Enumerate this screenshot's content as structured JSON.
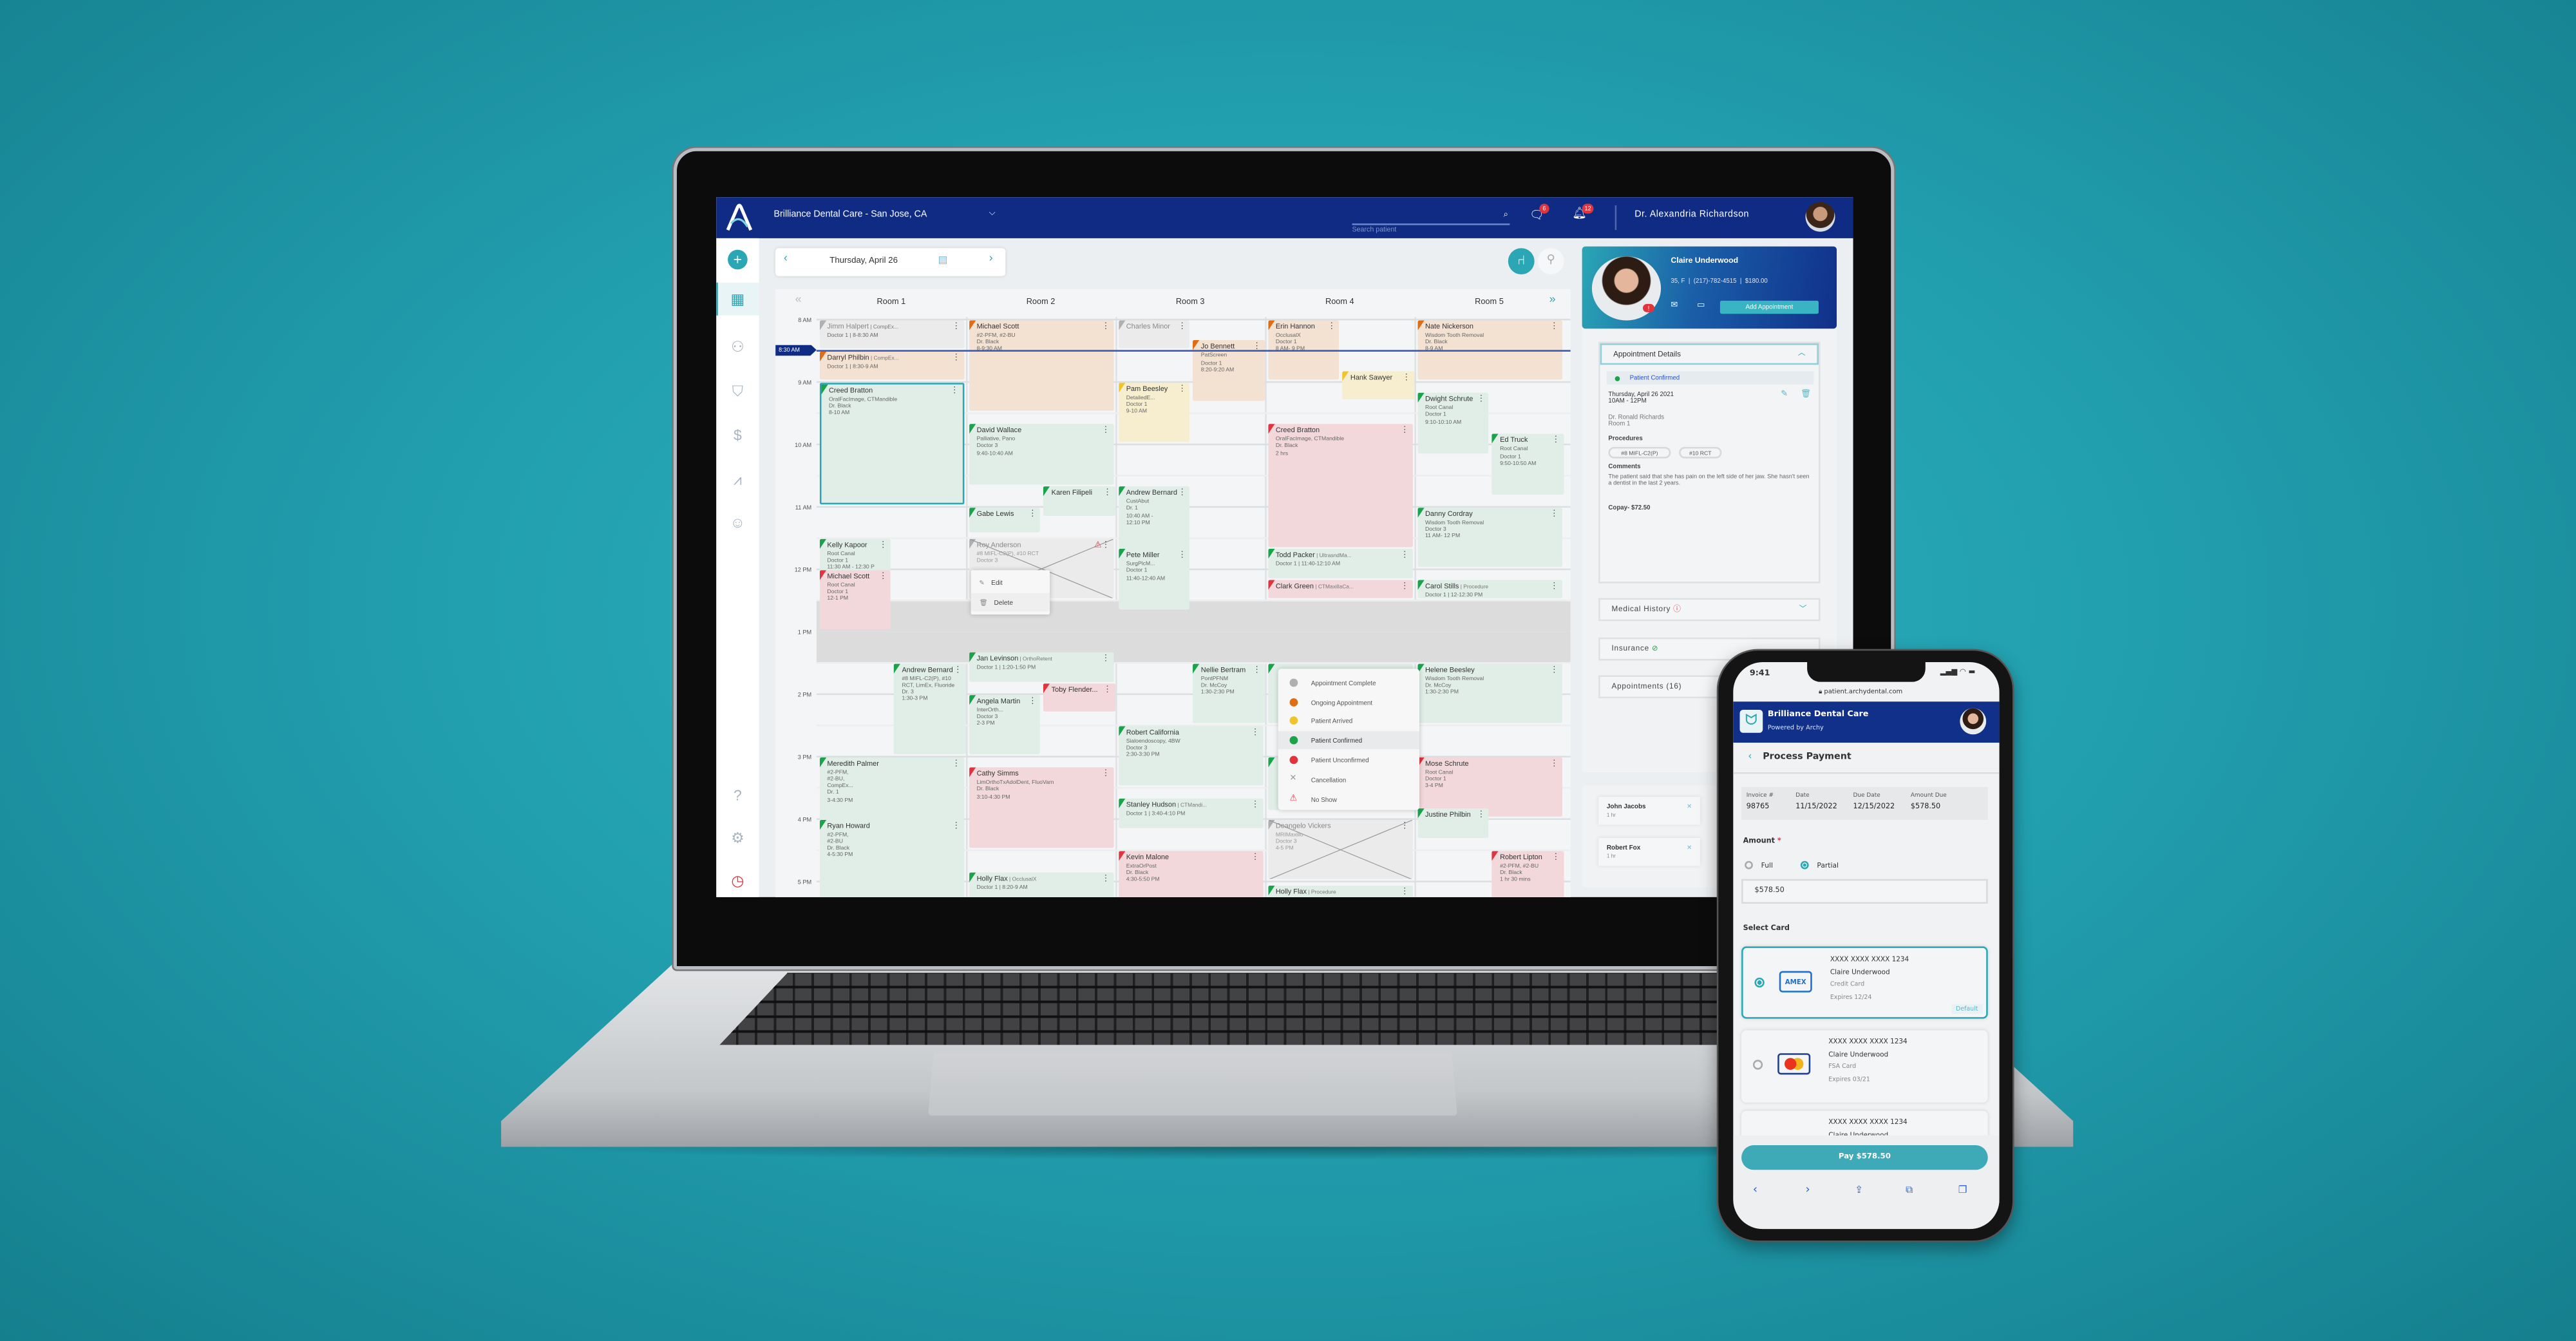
{
  "app": {
    "clinic": "Brilliance Dental Care - San Jose, CA",
    "search_placeholder": "Search patient",
    "messages_badge": "6",
    "notifications_badge": "12",
    "user": "Dr. Alexandria Richardson"
  },
  "schedule": {
    "date": "Thursday, April 26",
    "rooms": [
      "Room 1",
      "Room 2",
      "Room 3",
      "Room 4",
      "Room 5"
    ],
    "hours": [
      "8 AM",
      "9 AM",
      "10 AM",
      "11 AM",
      "12 PM",
      "1 PM",
      "2 PM",
      "3 PM",
      "4 PM",
      "5 PM"
    ],
    "current_time": "8:30 AM",
    "lunch": [
      12.5,
      13.5
    ],
    "appointments": [
      {
        "room": 1,
        "start": 8,
        "end": 8.5,
        "status": "complete",
        "name": "Jimm Halpert",
        "tag": " | CompEx...",
        "lines": [
          "Doctor 1 | 8-8:30 AM"
        ]
      },
      {
        "room": 1,
        "start": 8.5,
        "end": 9,
        "status": "ongoing",
        "name": "Darryl Philbin",
        "tag": " | CompEx...",
        "lines": [
          "Doctor 1 | 8:30-9 AM"
        ]
      },
      {
        "room": 1,
        "start": 9,
        "end": 11,
        "status": "confirmed",
        "selected": true,
        "name": "Creed Bratton",
        "tag": "",
        "lines": [
          "OralFacImage, CTMandible",
          "Dr. Black",
          "8-10 AM"
        ]
      },
      {
        "room": 1,
        "start": 11.5,
        "end": 12.5,
        "status": "confirmed",
        "name": "Kelly Kapoor",
        "tag": "",
        "lines": [
          "Root Canal",
          "Doctor 1",
          "11:30 AM - 12:30 P"
        ]
      },
      {
        "room": 1,
        "start": 12,
        "end": 13,
        "status": "unconfirmed",
        "name": "Michael Scott",
        "tag": "",
        "lines": [
          "Root Canal",
          "Doctor 1",
          "12-1 PM"
        ]
      },
      {
        "room": 1,
        "start": 13.5,
        "end": 15,
        "status": "confirmed",
        "name": "Andrew Bernard",
        "tag": "",
        "lines": [
          "#8 MIFL-C2(P), #10 RCT, LimEx, Fluoride",
          "Dr. 3",
          "1:30-3 PM"
        ]
      },
      {
        "room": 1,
        "start": 15,
        "end": 16.5,
        "status": "confirmed",
        "name": "Meredith Palmer",
        "tag": "",
        "lines": [
          "#2-PFM,",
          "#2-BU,",
          "CompEx...",
          "Dr. 1",
          "3-4:30 PM"
        ]
      },
      {
        "room": 1,
        "start": 16,
        "end": 17.5,
        "status": "confirmed",
        "name": "Ryan Howard",
        "tag": "",
        "lines": [
          "#2-PFM,",
          "#2-BU",
          "Dr. Black",
          "4-5:30 PM"
        ]
      },
      {
        "room": 2,
        "start": 8,
        "end": 9.5,
        "status": "ongoing",
        "name": "Michael Scott",
        "tag": "",
        "lines": [
          "#2-PFM, #2-BU",
          "Dr. Black",
          "8-9:30 AM"
        ]
      },
      {
        "room": 2,
        "start": 9.67,
        "end": 10.67,
        "status": "confirmed",
        "name": "David Wallace",
        "tag": "",
        "lines": [
          "Palliative, Pano",
          "Doctor 3",
          "9:40-10:40 AM"
        ]
      },
      {
        "room": 2,
        "start": 10.67,
        "end": 11.17,
        "status": "confirmed",
        "name": "Karen Filipeli",
        "tag": "",
        "lines": []
      },
      {
        "room": 2,
        "start": 11,
        "end": 11.45,
        "status": "confirmed",
        "name": "Gabe Lewis",
        "tag": "",
        "lines": []
      },
      {
        "room": 2,
        "start": 11.5,
        "end": 12.5,
        "status": "cancellation",
        "noshow": true,
        "name": "Roy Anderson",
        "tag": "",
        "lines": [
          "#8 MIFL-C2(P), #10 RCT",
          "Doctor 3"
        ]
      },
      {
        "room": 2,
        "start": 13.33,
        "end": 13.83,
        "status": "confirmed",
        "name": "Jan Levinson",
        "tag": " | OrthoRetent",
        "lines": [
          "Doctor 1 | 1:20-1:50 PM"
        ]
      },
      {
        "room": 2,
        "start": 14,
        "end": 15,
        "status": "confirmed",
        "name": "Angela Martin",
        "tag": "",
        "lines": [
          "InterOrth...",
          "Doctor 3",
          "2-3 PM"
        ]
      },
      {
        "room": 2,
        "start": 13.83,
        "end": 14.3,
        "status": "unconfirmed",
        "name": "Toby Flender...",
        "tag": "",
        "lines": []
      },
      {
        "room": 2,
        "start": 15.17,
        "end": 16.5,
        "status": "unconfirmed",
        "name": "Cathy Simms",
        "tag": "",
        "lines": [
          "LimOrthoTxAdolDent, FluoVarn",
          "Dr. Black",
          "3:10-4:30 PM"
        ]
      },
      {
        "room": 2,
        "start": 16.85,
        "end": 17.5,
        "status": "confirmed",
        "name": "Holly Flax",
        "tag": " | OcclusalX",
        "lines": [
          "Doctor 1 | 8:20-9 AM"
        ]
      },
      {
        "room": 3,
        "start": 8,
        "end": 8.5,
        "status": "complete",
        "name": "Charles Minor",
        "tag": "",
        "lines": []
      },
      {
        "room": 3,
        "start": 8.33,
        "end": 9.33,
        "status": "ongoing",
        "name": "Jo Bennett",
        "tag": "",
        "lines": [
          "PatScreen",
          "Doctor 1",
          "8:20-9:20 AM"
        ]
      },
      {
        "room": 3,
        "start": 9,
        "end": 10,
        "status": "arrived",
        "name": "Pam Beesley",
        "tag": "",
        "lines": [
          "DetailedE...",
          "Doctor 1",
          "9-10 AM"
        ]
      },
      {
        "room": 3,
        "start": 10.67,
        "end": 12.17,
        "status": "confirmed",
        "name": "Andrew Bernard",
        "tag": "",
        "lines": [
          "CustAbut",
          "Dr. 1",
          "10:40 AM -",
          "12:10 PM"
        ]
      },
      {
        "room": 3,
        "start": 11.67,
        "end": 12.67,
        "status": "confirmed",
        "name": "Pete Miller",
        "tag": "",
        "lines": [
          "SurgPlcM...",
          "Doctor 1",
          "11:40-12:40 AM"
        ]
      },
      {
        "room": 3,
        "start": 13.5,
        "end": 14.5,
        "status": "confirmed",
        "name": "Nellie Bertram",
        "tag": "",
        "lines": [
          "PontPFNM",
          "Dr. McCoy",
          "1:30-2:30 PM"
        ]
      },
      {
        "room": 3,
        "start": 14.5,
        "end": 15.5,
        "status": "confirmed",
        "name": "Robert California",
        "tag": "",
        "lines": [
          "Sialoendoscopy, 4BW",
          "Doctor 3",
          "2:30-3:30 PM"
        ]
      },
      {
        "room": 3,
        "start": 15.67,
        "end": 16.17,
        "status": "confirmed",
        "name": "Stanley Hudson",
        "tag": " | CTMandi...",
        "lines": [
          "Doctor 1 | 3:40-4:10 PM"
        ]
      },
      {
        "room": 3,
        "start": 16.5,
        "end": 17.85,
        "status": "unconfirmed",
        "name": "Kevin Malone",
        "tag": "",
        "lines": [
          "ExtraOrPost",
          "Dr. Black",
          "4:30-5:50 PM"
        ]
      },
      {
        "room": 4,
        "start": 8,
        "end": 9,
        "status": "ongoing",
        "name": "Erin Hannon",
        "tag": "",
        "lines": [
          "OcclusalX",
          "Doctor 1",
          "8 AM- 9 PM"
        ]
      },
      {
        "room": 4,
        "start": 8.83,
        "end": 9.3,
        "status": "arrived",
        "name": "Hank Sawyer",
        "tag": "",
        "lines": []
      },
      {
        "room": 4,
        "start": 9.67,
        "end": 11.67,
        "status": "unconfirmed",
        "name": "Creed Bratton",
        "tag": "",
        "lines": [
          "OralFacImage, CTMandible",
          "Dr. Black",
          "2 hrs"
        ]
      },
      {
        "room": 4,
        "start": 11.67,
        "end": 12.17,
        "status": "confirmed",
        "name": "Todd Packer",
        "tag": " | UltrasndMa...",
        "lines": [
          "Doctor 1 | 11:40-12:10 AM"
        ]
      },
      {
        "room": 4,
        "start": 12.17,
        "end": 12.5,
        "status": "unconfirmed",
        "name": "Clark Green",
        "tag": " | CTMaxillaCa...",
        "lines": []
      },
      {
        "room": 4,
        "start": 13.5,
        "end": 14.5,
        "status": "confirmed",
        "name": "",
        "tag": "",
        "lines": []
      },
      {
        "room": 4,
        "start": 15,
        "end": 15.9,
        "status": "confirmed",
        "name": "",
        "tag": "",
        "lines": []
      },
      {
        "room": 4,
        "start": 16,
        "end": 17,
        "status": "cancellation",
        "name": "Deangelo Vickers",
        "tag": "",
        "lines": [
          "MRIMaxillo",
          "Doctor 3",
          "4-5 PM"
        ]
      },
      {
        "room": 4,
        "start": 17.05,
        "end": 17.5,
        "status": "confirmed",
        "name": "Holly Flax",
        "tag": " | Procedure",
        "lines": []
      },
      {
        "room": 5,
        "start": 8,
        "end": 9,
        "status": "ongoing",
        "name": "Nate Nickerson",
        "tag": "",
        "lines": [
          "Wisdom Tooth Removal",
          "Dr. Black",
          "8-9 AM"
        ]
      },
      {
        "room": 5,
        "start": 9.17,
        "end": 10.17,
        "status": "confirmed",
        "name": "Dwight Schrute",
        "tag": "",
        "lines": [
          "Root Canal",
          "Doctor 1",
          "9:10-10:10 AM"
        ]
      },
      {
        "room": 5,
        "start": 9.83,
        "end": 10.83,
        "status": "confirmed",
        "name": "Ed Truck",
        "tag": "",
        "lines": [
          "Root Canal",
          "Doctor 1",
          "9:50-10:50 AM"
        ]
      },
      {
        "room": 5,
        "start": 11,
        "end": 12,
        "status": "confirmed",
        "name": "Danny Cordray",
        "tag": "",
        "lines": [
          "Wisdom Tooth Removal",
          "Doctor 3",
          "11 AM- 12 PM"
        ]
      },
      {
        "room": 5,
        "start": 12.17,
        "end": 12.5,
        "status": "confirmed",
        "name": "Carol Stills",
        "tag": " | Procedure",
        "lines": [
          "Doctor 1 | 12-12:30 PM"
        ]
      },
      {
        "room": 5,
        "start": 13.5,
        "end": 14.5,
        "status": "confirmed",
        "name": "Helene Beesley",
        "tag": "",
        "lines": [
          "Wisdom Tooth Removal",
          "Dr. McCoy",
          "1:30-2:30 PM"
        ]
      },
      {
        "room": 5,
        "start": 15,
        "end": 16,
        "status": "unconfirmed",
        "name": "Mose Schrute",
        "tag": "",
        "lines": [
          "Root Canal",
          "Doctor 1",
          "3-4 PM"
        ]
      },
      {
        "room": 5,
        "start": 15.83,
        "end": 16.33,
        "status": "confirmed",
        "name": "Justine Philbin",
        "tag": "",
        "lines": []
      },
      {
        "room": 5,
        "start": 16.5,
        "end": 17.85,
        "status": "unconfirmed",
        "name": "Robert Lipton",
        "tag": "",
        "lines": [
          "#2-PFM, #2-BU",
          "Dr. Black",
          "1 hr 30 mins"
        ]
      }
    ],
    "context_menu": [
      "Edit",
      "Delete"
    ],
    "legend": [
      {
        "label": "Appointment Complete",
        "status": "complete"
      },
      {
        "label": "Ongoing Appointment",
        "status": "ongoing"
      },
      {
        "label": "Patient Arrived",
        "status": "arrived"
      },
      {
        "label": "Patient Confirmed",
        "status": "confirmed"
      },
      {
        "label": "Patient Unconfirmed",
        "status": "unconfirmed"
      },
      {
        "label": "Cancellation",
        "status": "cancellation"
      },
      {
        "label": "No Show",
        "status": "noshow"
      }
    ]
  },
  "status_colors": {
    "complete": "#b0b0b0",
    "ongoing": "#e06c14",
    "arrived": "#f0c52c",
    "confirmed": "#1aa34a",
    "unconfirmed": "#e0343f",
    "cancellation": "#b0b0b0",
    "noshow": "#e0343f"
  },
  "status_fills": {
    "complete": "#ebebeb",
    "ongoing": "#f3e1d2",
    "arrived": "#f6eecf",
    "confirmed": "#e0eee7",
    "unconfirmed": "#f3d8db",
    "cancellation": "#ebebeb"
  },
  "patient": {
    "name": "Claire Underwood",
    "info": "35, F  |  (217)-782-4515  |  $180.00",
    "add_button": "Add Appointment",
    "details_title": "Appointment Details",
    "status": "Patient Confirmed",
    "date": "Thursday, April 26 2021",
    "time": "10AM - 12PM",
    "doctor": "Dr. Ronald Richards",
    "room": "Room 1",
    "procedures_label": "Procedures",
    "procedures": [
      "#8 MIFL-C2(P)",
      "#10 RCT"
    ],
    "comments_label": "Comments",
    "comments": "The patient said that she has pain on the left side of her jaw. She hasn't seen a dentist in the last 2 years.",
    "copay": "Copay- $72.50",
    "medical_history": "Medical History",
    "insurance": "Insurance",
    "appointments": "Appointments (16)"
  },
  "waitlist": [
    {
      "name": "John Jacobs",
      "duration": "1 hr"
    },
    {
      "name": "Robert Fox",
      "duration": "1 hr"
    }
  ],
  "phone": {
    "time": "9:41",
    "url": "patient.archydental.com",
    "clinic": "Brilliance Dental Care",
    "powered": "Powered by Archy",
    "title": "Process Payment",
    "invoice": [
      {
        "label": "Invoice #",
        "value": "98765"
      },
      {
        "label": "Date",
        "value": "11/15/2022"
      },
      {
        "label": "Due Date",
        "value": "12/15/2022"
      },
      {
        "label": "Amount Due",
        "value": "$578.50"
      }
    ],
    "amount_label": "Amount",
    "full": "Full",
    "partial": "Partial",
    "amount_value": "$578.50",
    "select_card": "Select Card",
    "cards": [
      {
        "number": "XXXX XXXX XXXX 1234",
        "holder": "Claire Underwood",
        "type": "Credit Card",
        "expires": "Expires 12/24",
        "brand": "AMEX",
        "default": "Default"
      },
      {
        "number": "XXXX XXXX XXXX 1234",
        "holder": "Claire Underwood",
        "type": "FSA Card",
        "expires": "Expires 03/21",
        "brand": "mastercard"
      },
      {
        "number": "XXXX XXXX XXXX 1234",
        "holder": "Claire Underwood"
      }
    ],
    "pay_button": "Pay $578.50"
  }
}
